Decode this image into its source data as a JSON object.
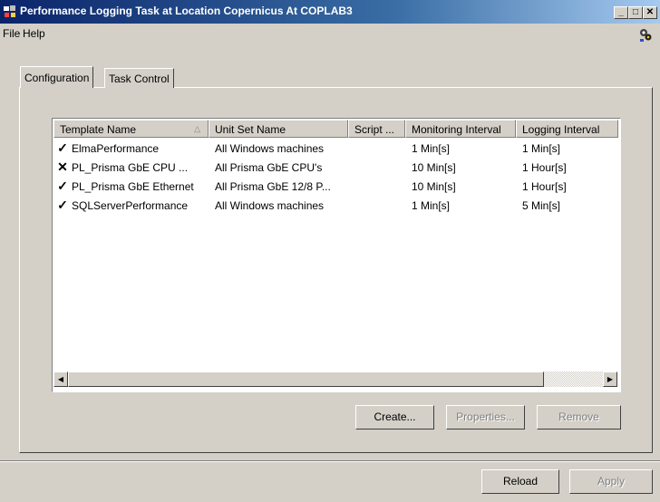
{
  "window": {
    "title": "Performance Logging Task at Location Copernicus At COPLAB3",
    "minimize": "_",
    "maximize": "□",
    "close": "✕"
  },
  "menu": {
    "file": "File",
    "help": "Help"
  },
  "tabs": [
    {
      "label": "Configuration",
      "active": true
    },
    {
      "label": "Task Control",
      "active": false
    }
  ],
  "table": {
    "columns": [
      "Template Name",
      "Unit Set Name",
      "Script ...",
      "Monitoring Interval",
      "Logging Interval"
    ],
    "sort_indicator": "△",
    "rows": [
      {
        "status": "✓",
        "name": "ElmaPerformance",
        "unit_set": "All Windows machines",
        "script": "",
        "monitoring": "1 Min[s]",
        "logging": "1 Min[s]"
      },
      {
        "status": "✕",
        "name": "PL_Prisma GbE CPU ...",
        "unit_set": "All Prisma GbE CPU's",
        "script": "",
        "monitoring": "10 Min[s]",
        "logging": "1 Hour[s]"
      },
      {
        "status": "✓",
        "name": "PL_Prisma GbE Ethernet",
        "unit_set": "All Prisma GbE 12/8 P...",
        "script": "",
        "monitoring": "10 Min[s]",
        "logging": "1 Hour[s]"
      },
      {
        "status": "✓",
        "name": "SQLServerPerformance",
        "unit_set": "All Windows machines",
        "script": "",
        "monitoring": "1 Min[s]",
        "logging": "5 Min[s]"
      }
    ]
  },
  "scroll": {
    "left_arrow": "◀",
    "right_arrow": "▶"
  },
  "buttons": {
    "create": "Create...",
    "properties": "Properties...",
    "remove": "Remove",
    "reload": "Reload",
    "apply": "Apply"
  },
  "icons": {
    "app": "app-window-icon",
    "help": "gear-people-icon"
  }
}
